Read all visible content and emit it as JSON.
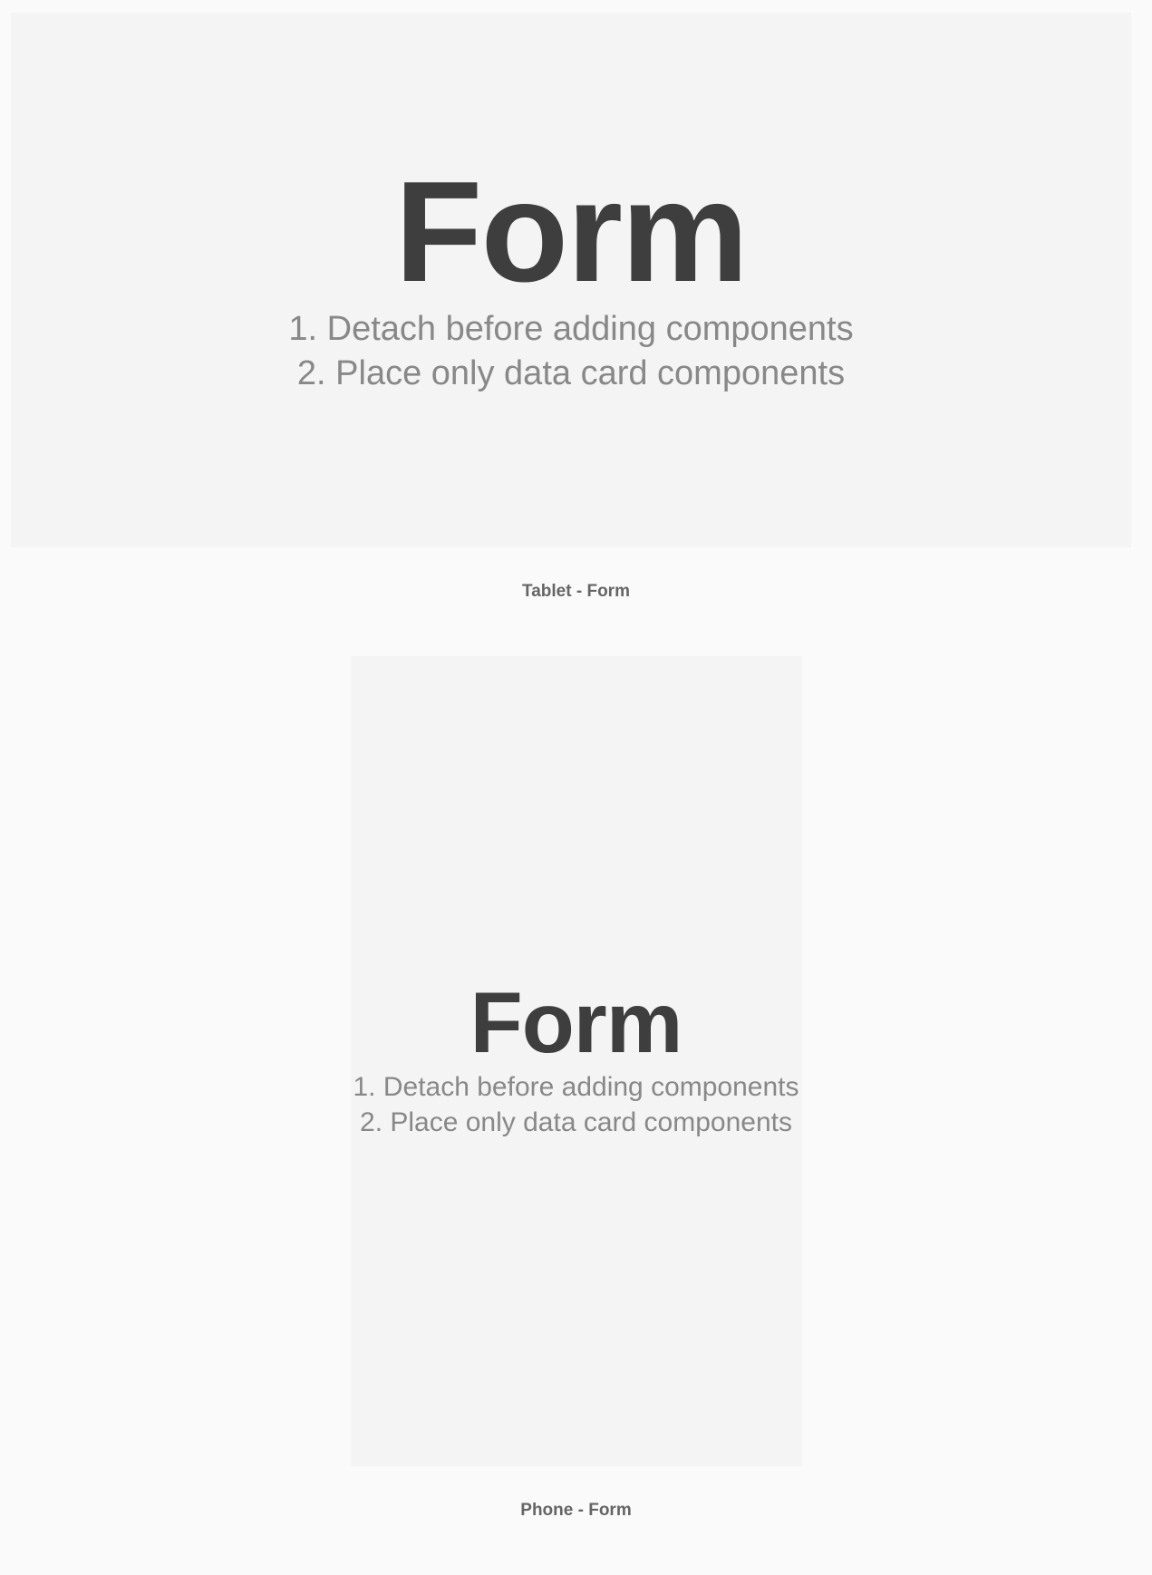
{
  "tablet": {
    "title": "Form",
    "instruction1": "1. Detach before adding components",
    "instruction2": "2. Place only data card components",
    "caption": "Tablet - Form"
  },
  "phone": {
    "title": "Form",
    "instruction1": "1. Detach before adding components",
    "instruction2": "2. Place only data card components",
    "caption": "Phone - Form"
  }
}
